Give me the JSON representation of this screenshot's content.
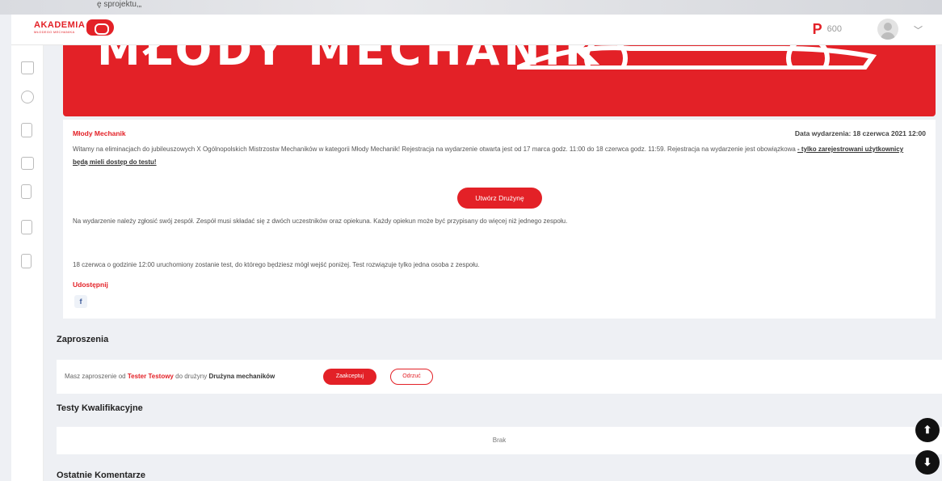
{
  "top_strip": {
    "text": "ę sprojektu,„"
  },
  "header": {
    "logo_text": "AKADEMIA",
    "logo_sub": "MŁODEGO MECHANIKA",
    "points": "600",
    "points_icon": "points-icon"
  },
  "sidebar": {
    "icons": [
      "home-icon",
      "user-icon",
      "document-icon",
      "calendar-icon",
      "phone-icon",
      "edit-icon",
      "clipboard-icon"
    ]
  },
  "hero": {
    "text": "MŁODY MECHANIK"
  },
  "event": {
    "title": "Młody Mechanik",
    "date": "Data wydarzenia: 18 czerwca 2021 12:00",
    "description": "Witamy na eliminacjach do jubileuszowych X Ogólnopolskich Mistrzostw Mechaników w kategorii Młody Mechanik! Rejestracja na wydarzenie otwarta jest od 17 marca godz. 11:00 do 18 czerwca godz. 11:59. Rejestracja na wydarzenie jest obowiązkowa ",
    "description_link": "- tylko zarejestrowani użytkownicy będą mieli dostęp do testu!",
    "create_team_button": "Utwórz Drużynę",
    "team_info": "Na wydarzenie należy zgłosić swój zespół. Zespół musi składać się z dwóch uczestników oraz opiekuna. Każdy opiekun może być przypisany do więcej niż jednego zespołu.",
    "test_info": "18 czerwca o godzinie 12:00 uruchomiony zostanie test, do którego będziesz mógł wejść poniżej. Test rozwiązuje tylko jedna osoba z zespołu.",
    "share_label": "Udostępnij",
    "facebook": "f"
  },
  "invitations": {
    "title": "Zaproszenia",
    "text_before": "Masz zaproszenie od ",
    "from": "Tester Testowy",
    "text_middle": " do drużyny ",
    "team": "Drużyna mechaników",
    "accept": "Zaakceptuj",
    "reject": "Odrzuć"
  },
  "tests": {
    "title": "Testy Kwalifikacyjne",
    "empty": "Brak"
  },
  "comments": {
    "title": "Ostatnie Komentarze"
  },
  "fab": {
    "up": "⬆",
    "down": "⬇"
  },
  "colors": {
    "accent": "#e32127",
    "background": "#eef0f4"
  }
}
